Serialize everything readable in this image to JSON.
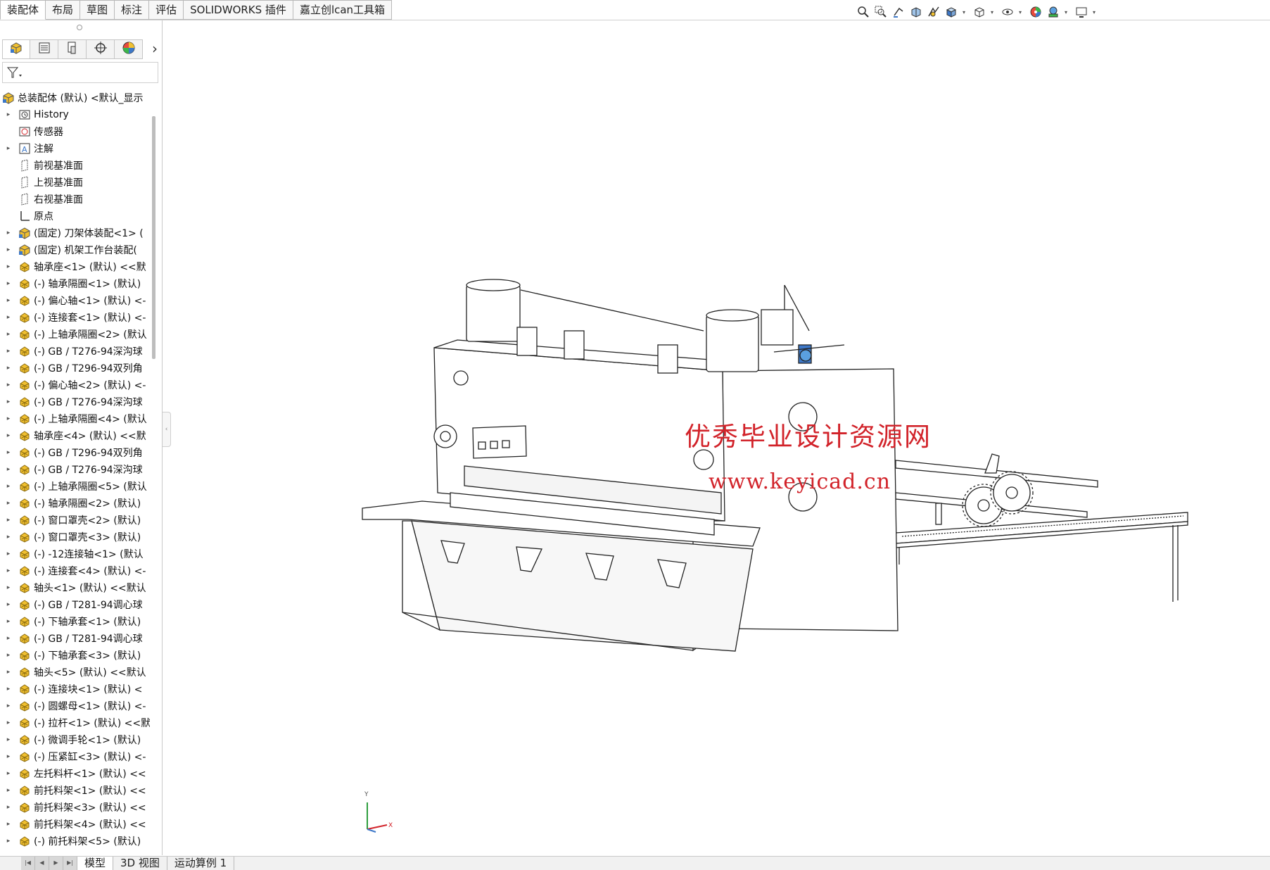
{
  "tabs": [
    {
      "label": "装配体",
      "active": true
    },
    {
      "label": "布局",
      "active": false
    },
    {
      "label": "草图",
      "active": false
    },
    {
      "label": "标注",
      "active": false
    },
    {
      "label": "评估",
      "active": false
    },
    {
      "label": "SOLIDWORKS 插件",
      "active": false
    },
    {
      "label": "嘉立创lcan工具箱",
      "active": false
    }
  ],
  "hud_icons": [
    "zoom-to-fit-icon",
    "zoom-area-icon",
    "previous-view-icon",
    "section-view-icon",
    "dynamic-annotation-icon",
    "view-orientation-icon",
    "display-style-icon",
    "hide-show-icon",
    "edit-appearance-icon",
    "apply-scene-icon",
    "view-settings-icon"
  ],
  "manager_tabs": [
    "featuremanager-icon",
    "propertymanager-icon",
    "configurationmanager-icon",
    "dimxpert-icon",
    "displaymanager-icon"
  ],
  "tree": {
    "root": "总装配体 (默认) <默认_显示",
    "items": [
      {
        "label": "History",
        "icon": "history-icon",
        "expand": true
      },
      {
        "label": "传感器",
        "icon": "sensor-icon",
        "expand": false
      },
      {
        "label": "注解",
        "icon": "annotation-icon",
        "expand": true
      },
      {
        "label": "前视基准面",
        "icon": "plane-icon",
        "expand": false
      },
      {
        "label": "上视基准面",
        "icon": "plane-icon",
        "expand": false
      },
      {
        "label": "右视基准面",
        "icon": "plane-icon",
        "expand": false
      },
      {
        "label": "原点",
        "icon": "origin-icon",
        "expand": false
      },
      {
        "label": "(固定) 刀架体装配<1> (",
        "icon": "assembly-icon",
        "expand": true
      },
      {
        "label": "(固定) 机架工作台装配(",
        "icon": "assembly-icon",
        "expand": true
      },
      {
        "label": "轴承座<1> (默认) <<默",
        "icon": "part-icon",
        "expand": true
      },
      {
        "label": "(-) 轴承隔圈<1> (默认)",
        "icon": "part-icon",
        "expand": true
      },
      {
        "label": "(-) 偏心轴<1> (默认) <-",
        "icon": "part-icon",
        "expand": true
      },
      {
        "label": "(-) 连接套<1> (默认) <-",
        "icon": "part-icon",
        "expand": true
      },
      {
        "label": "(-) 上轴承隔圈<2> (默认",
        "icon": "part-icon",
        "expand": true
      },
      {
        "label": "(-) GB / T276-94深沟球",
        "icon": "part-icon",
        "expand": true
      },
      {
        "label": "(-) GB / T296-94双列角",
        "icon": "part-icon",
        "expand": true
      },
      {
        "label": "(-) 偏心轴<2> (默认) <-",
        "icon": "part-icon",
        "expand": true
      },
      {
        "label": "(-) GB / T276-94深沟球",
        "icon": "part-icon",
        "expand": true
      },
      {
        "label": "(-) 上轴承隔圈<4> (默认",
        "icon": "part-icon",
        "expand": true
      },
      {
        "label": "轴承座<4> (默认) <<默",
        "icon": "part-icon",
        "expand": true
      },
      {
        "label": "(-) GB / T296-94双列角",
        "icon": "part-icon",
        "expand": true
      },
      {
        "label": "(-) GB / T276-94深沟球",
        "icon": "part-icon",
        "expand": true
      },
      {
        "label": "(-) 上轴承隔圈<5> (默认",
        "icon": "part-icon",
        "expand": true
      },
      {
        "label": "(-) 轴承隔圈<2> (默认)",
        "icon": "part-icon",
        "expand": true
      },
      {
        "label": "(-) 窗口罩壳<2> (默认)",
        "icon": "part-icon",
        "expand": true
      },
      {
        "label": "(-) 窗口罩壳<3> (默认)",
        "icon": "part-icon",
        "expand": true
      },
      {
        "label": "(-) -12连接轴<1> (默认",
        "icon": "part-icon",
        "expand": true
      },
      {
        "label": "(-) 连接套<4> (默认) <-",
        "icon": "part-icon",
        "expand": true
      },
      {
        "label": "轴头<1> (默认) <<默认",
        "icon": "part-icon",
        "expand": true
      },
      {
        "label": "(-) GB / T281-94调心球",
        "icon": "part-icon",
        "expand": true
      },
      {
        "label": "(-) 下轴承套<1> (默认)",
        "icon": "part-icon",
        "expand": true
      },
      {
        "label": "(-) GB / T281-94调心球",
        "icon": "part-icon",
        "expand": true
      },
      {
        "label": "(-) 下轴承套<3> (默认)",
        "icon": "part-icon",
        "expand": true
      },
      {
        "label": "轴头<5> (默认) <<默认",
        "icon": "part-icon",
        "expand": true
      },
      {
        "label": "(-) 连接块<1> (默认) <",
        "icon": "part-icon",
        "expand": true
      },
      {
        "label": "(-) 圆螺母<1> (默认) <-",
        "icon": "part-icon",
        "expand": true
      },
      {
        "label": "(-) 拉杆<1> (默认) <<默",
        "icon": "part-icon",
        "expand": true
      },
      {
        "label": "(-) 微调手轮<1> (默认)",
        "icon": "part-icon",
        "expand": true
      },
      {
        "label": "(-) 压紧缸<3> (默认) <-",
        "icon": "part-icon",
        "expand": true
      },
      {
        "label": "左托料杆<1> (默认) <<",
        "icon": "part-icon",
        "expand": true
      },
      {
        "label": "前托料架<1> (默认) <<",
        "icon": "part-icon",
        "expand": true
      },
      {
        "label": "前托料架<3> (默认) <<",
        "icon": "part-icon",
        "expand": true
      },
      {
        "label": "前托料架<4> (默认) <<",
        "icon": "part-icon",
        "expand": true
      },
      {
        "label": "(-) 前托料架<5> (默认)",
        "icon": "part-icon",
        "expand": true
      }
    ]
  },
  "viewport": {
    "watermark": "优秀毕业设计资源网",
    "watermark_url": "www.keyicad.cn",
    "triad": {
      "x": "X",
      "y": "Y"
    }
  },
  "bottom_tabs": [
    {
      "label": "模型",
      "active": true
    },
    {
      "label": "3D 视图",
      "active": false
    },
    {
      "label": "运动算例 1",
      "active": false
    }
  ],
  "colors": {
    "watermark": "#d2232a",
    "part_icon": "#f0c030",
    "assembly_icon": "#3d78c8"
  }
}
